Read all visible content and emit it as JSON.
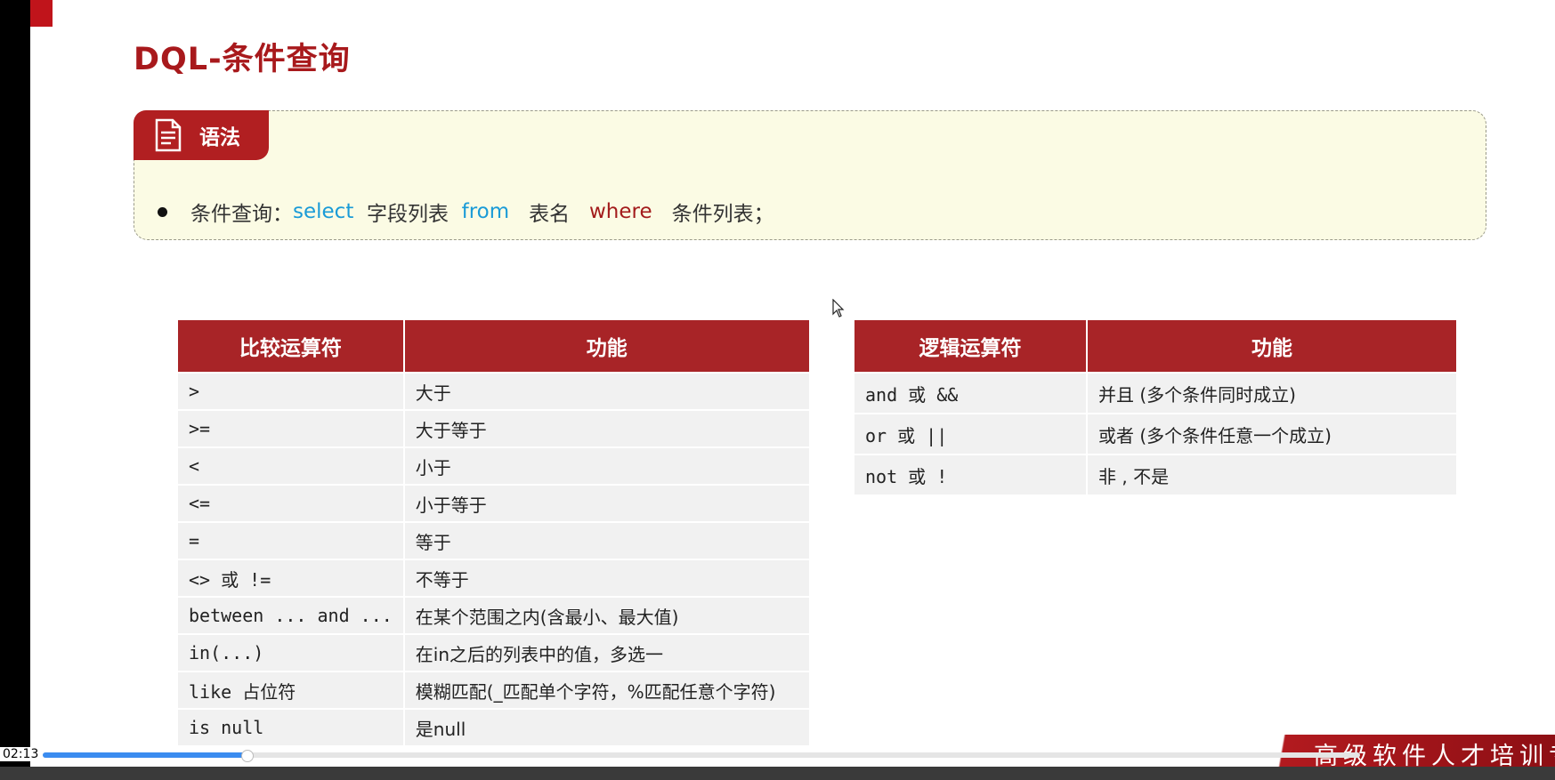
{
  "slide": {
    "title": "DQL-条件查询",
    "syntax": {
      "tag_label": "语法",
      "prefix": "条件查询：",
      "kw_select": "select",
      "part_fields": "字段列表",
      "kw_from": "from",
      "part_table": "表名",
      "kw_where": "where",
      "part_conditions": "条件列表；"
    }
  },
  "comparison_table": {
    "headers": [
      "比较运算符",
      "功能"
    ],
    "rows": [
      {
        "op": ">",
        "desc": "大于"
      },
      {
        "op": ">=",
        "desc": "大于等于"
      },
      {
        "op": "<",
        "desc": "小于"
      },
      {
        "op": "<=",
        "desc": "小于等于"
      },
      {
        "op": "=",
        "desc": "等于"
      },
      {
        "op": "<>  或 !=",
        "desc": "不等于"
      },
      {
        "op": "between ... and ...",
        "desc": "在某个范围之内(含最小、最大值)"
      },
      {
        "op": "in(...)",
        "desc": "在in之后的列表中的值，多选一"
      },
      {
        "op": "like  占位符",
        "desc": "模糊匹配(_匹配单个字符，%匹配任意个字符)"
      },
      {
        "op": "is null",
        "desc": "是null"
      }
    ]
  },
  "logic_table": {
    "headers": [
      "逻辑运算符",
      "功能"
    ],
    "rows": [
      {
        "op": "and  或  &&",
        "desc": "并且 (多个条件同时成立)"
      },
      {
        "op": "or  或  ||",
        "desc": "或者 (多个条件任意一个成立)"
      },
      {
        "op": "not  或  !",
        "desc": "非 , 不是"
      }
    ]
  },
  "banner": {
    "text": "高级软件人才培训专"
  },
  "player": {
    "time": "02:13",
    "progress_percent": 15.5
  },
  "colors": {
    "accent_red": "#a82427",
    "keyword_blue": "#1a9bd7",
    "syntax_bg": "#fbfbe4",
    "progress_blue": "#3b8cf0"
  },
  "icons": {
    "syntax": "document-icon",
    "cursor": "mouse-pointer-icon"
  }
}
